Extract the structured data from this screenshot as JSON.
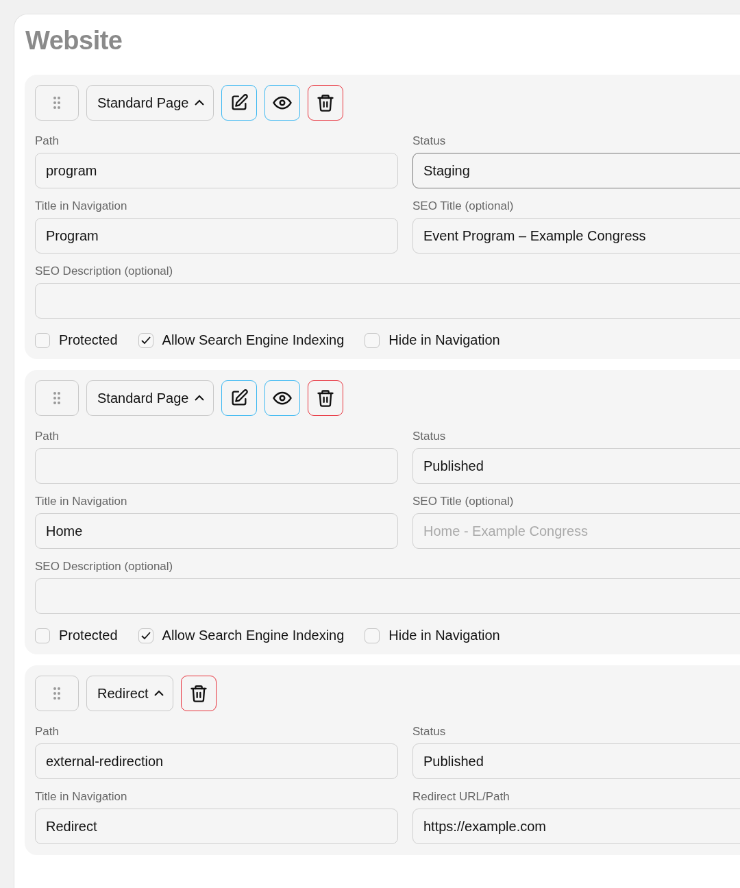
{
  "title": "Website",
  "pages": [
    {
      "type_label": "Standard Page",
      "expanded": true,
      "actions": [
        {
          "kind": "edit"
        },
        {
          "kind": "preview"
        },
        {
          "kind": "delete"
        }
      ],
      "fields": [
        {
          "label": "Path",
          "value": "program",
          "kind": "half",
          "focused": false
        },
        {
          "label": "Status",
          "value": "Staging",
          "kind": "half",
          "focused": true
        },
        {
          "label": "Title in Navigation",
          "value": "Program",
          "kind": "half",
          "focused": false
        },
        {
          "label": "SEO Title (optional)",
          "value": "Event Program – Example Congress",
          "kind": "half",
          "focused": false
        },
        {
          "label": "SEO Description (optional)",
          "kind": "wide",
          "focused": false
        }
      ],
      "options": [
        {
          "label": "Protected",
          "checked": false
        },
        {
          "label": "Allow Search Engine Indexing",
          "checked": true
        },
        {
          "label": "Hide in Navigation",
          "checked": false
        }
      ]
    },
    {
      "type_label": "Standard Page",
      "expanded": true,
      "actions": [
        {
          "kind": "edit"
        },
        {
          "kind": "preview"
        },
        {
          "kind": "delete"
        }
      ],
      "fields": [
        {
          "label": "Path",
          "kind": "half",
          "focused": false
        },
        {
          "label": "Status",
          "value": "Published",
          "kind": "half",
          "focused": false
        },
        {
          "label": "Title in Navigation",
          "value": "Home",
          "kind": "half",
          "focused": false
        },
        {
          "label": "SEO Title (optional)",
          "placeholder": "Home - Example Congress",
          "kind": "half",
          "focused": false
        },
        {
          "label": "SEO Description (optional)",
          "kind": "wide",
          "focused": false
        }
      ],
      "options": [
        {
          "label": "Protected",
          "checked": false
        },
        {
          "label": "Allow Search Engine Indexing",
          "checked": true
        },
        {
          "label": "Hide in Navigation",
          "checked": false
        }
      ]
    },
    {
      "type_label": "Redirect",
      "expanded": true,
      "actions": [
        {
          "kind": "delete"
        }
      ],
      "fields": [
        {
          "label": "Path",
          "value": "external-redirection",
          "kind": "half",
          "focused": false
        },
        {
          "label": "Status",
          "value": "Published",
          "kind": "half",
          "focused": false
        },
        {
          "label": "Title in Navigation",
          "value": "Redirect",
          "kind": "half",
          "focused": false
        },
        {
          "label": "Redirect URL/Path",
          "value": "https://example.com",
          "kind": "half",
          "focused": false
        }
      ]
    }
  ]
}
